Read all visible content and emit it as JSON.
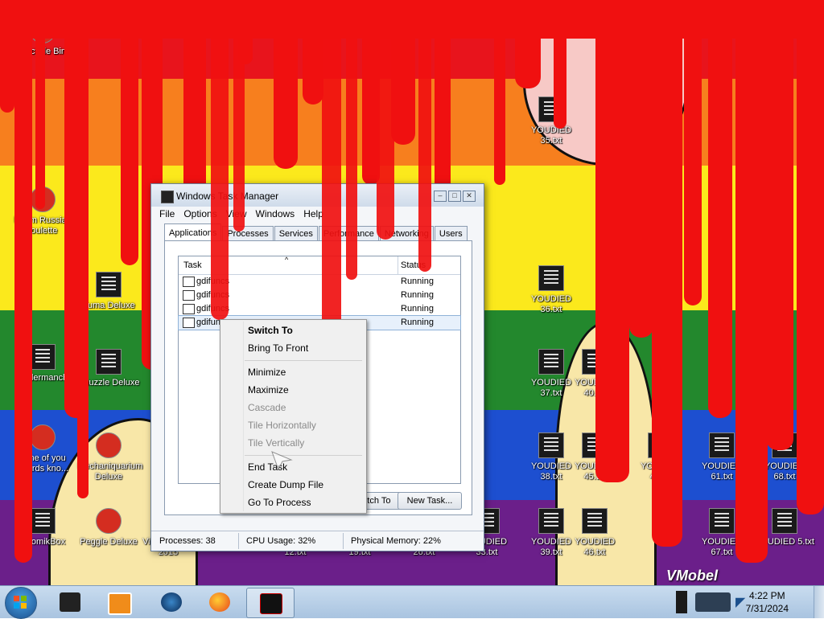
{
  "desktop": {
    "icons": [
      {
        "label": "Recycle Bin",
        "kind": "round"
      },
      {
        "label": "Boom Russian roulette",
        "kind": "round"
      },
      {
        "label": "Endermanch",
        "kind": "file"
      },
      {
        "label": "none of you retards kno...",
        "kind": "round"
      },
      {
        "label": "ChomikBox",
        "kind": "file"
      },
      {
        "label": "Zuma Deluxe",
        "kind": "file"
      },
      {
        "label": "Chuzzle Deluxe",
        "kind": "file"
      },
      {
        "label": "Mechaniquarium Deluxe",
        "kind": "round"
      },
      {
        "label": "Peggle Deluxe",
        "kind": "round"
      },
      {
        "label": "Visual Studio 2015",
        "kind": "file"
      },
      {
        "label": "YOUDIED 5.txt",
        "kind": "file"
      },
      {
        "label": "YOUDIED 12.txt",
        "kind": "file"
      },
      {
        "label": "YOUDIED 19.txt",
        "kind": "file"
      },
      {
        "label": "YOUDIED 26.txt",
        "kind": "file"
      },
      {
        "label": "YOUDIED 33.txt",
        "kind": "file"
      },
      {
        "label": "YOUDIED 35.txt",
        "kind": "file"
      },
      {
        "label": "YOUDIED 36.txt",
        "kind": "file"
      },
      {
        "label": "YOUDIED 37.txt",
        "kind": "file"
      },
      {
        "label": "YOUDIED 38.txt",
        "kind": "file"
      },
      {
        "label": "YOUDIED 39.txt",
        "kind": "file"
      },
      {
        "label": "YOUDIED 40.txt",
        "kind": "file"
      },
      {
        "label": "YOUDIED 45.txt",
        "kind": "file"
      },
      {
        "label": "YOUDIED 46.txt",
        "kind": "file"
      },
      {
        "label": "YOUDIED 47.txt",
        "kind": "file"
      },
      {
        "label": "YOUDIED 61.txt",
        "kind": "file"
      },
      {
        "label": "YOUDIED 68.txt",
        "kind": "file"
      },
      {
        "label": "YOUDIED 67.txt",
        "kind": "file"
      },
      {
        "label": "YOUDIED 5.txt",
        "kind": "file"
      }
    ],
    "watermark": "VMobel"
  },
  "taskmanager": {
    "title": "Windows Task Manager",
    "menu": [
      "File",
      "Options",
      "View",
      "Windows",
      "Help"
    ],
    "tabs": [
      "Applications",
      "Processes",
      "Services",
      "Performance",
      "Networking",
      "Users"
    ],
    "columns": {
      "task": "Task",
      "status": "Status"
    },
    "rows": [
      {
        "task": "gdifuncs",
        "status": "Running"
      },
      {
        "task": "gdifuncs",
        "status": "Running"
      },
      {
        "task": "gdifuncs",
        "status": "Running"
      },
      {
        "task": "gdifuncs",
        "status": "Running"
      }
    ],
    "buttons": {
      "switch_to": "Switch To",
      "new_task": "New Task..."
    },
    "status": {
      "processes": "Processes: 38",
      "cpu": "CPU Usage: 32%",
      "memory": "Physical Memory: 22%"
    }
  },
  "context_menu": {
    "items": [
      {
        "label": "Switch To",
        "disabled": false,
        "bold": true
      },
      {
        "label": "Bring To Front",
        "disabled": false
      },
      {
        "label": "Minimize",
        "disabled": false
      },
      {
        "label": "Maximize",
        "disabled": false
      },
      {
        "label": "Cascade",
        "disabled": true
      },
      {
        "label": "Tile Horizontally",
        "disabled": true
      },
      {
        "label": "Tile Vertically",
        "disabled": true
      },
      {
        "label": "End Task",
        "disabled": false
      },
      {
        "label": "Create Dump File",
        "disabled": false
      },
      {
        "label": "Go To Process",
        "disabled": false
      }
    ]
  },
  "taskbar": {
    "time": "4:22 PM",
    "date": "7/31/2024",
    "buttons": [
      "start-orb",
      "task-manager",
      "media-player",
      "globe",
      "firefox",
      "gdifuncs"
    ]
  },
  "colors": {
    "blood": "#f01010",
    "taskbar": "#bcd2ea",
    "window": "#f4f6f9"
  }
}
